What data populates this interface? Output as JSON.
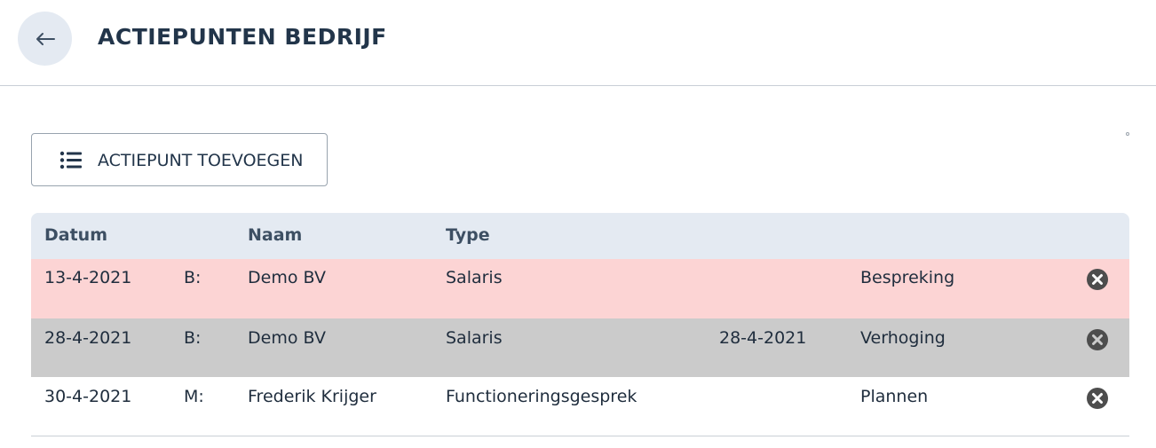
{
  "header": {
    "back_icon": "arrow-left-icon",
    "title": "ACTIEPUNTEN BEDRIJF"
  },
  "toolbar": {
    "add_icon": "list-icon",
    "add_label": "ACTIEPUNT TOEVOEGEN"
  },
  "table": {
    "columns": [
      "Datum",
      "Naam",
      "Type"
    ],
    "rows": [
      {
        "datum": "13-4-2021",
        "prefix": "B:",
        "naam": "Demo BV",
        "type": "Salaris",
        "datum2": "",
        "status": "Bespreking",
        "bg": "#fcd4d4"
      },
      {
        "datum": "28-4-2021",
        "prefix": "B:",
        "naam": "Demo BV",
        "type": "Salaris",
        "datum2": "28-4-2021",
        "status": "Verhoging",
        "bg": "#cbcbcb"
      },
      {
        "datum": "30-4-2021",
        "prefix": "M:",
        "naam": "Frederik Krijger",
        "type": "Functioneringsgesprek",
        "datum2": "",
        "status": "Plannen",
        "bg": "#ffffff"
      }
    ],
    "delete_icon": "close-circle-icon"
  },
  "colors": {
    "accent": "#22354a",
    "header_bg": "#e4eaf2",
    "overdue_row": "#fcd4d4",
    "done_row": "#cbcbcb"
  }
}
